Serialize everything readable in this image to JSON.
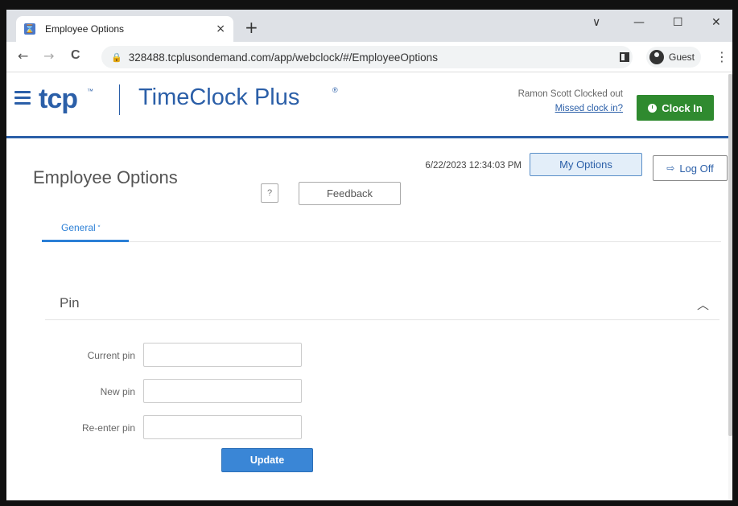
{
  "browser": {
    "tab_title": "Employee Options",
    "tab_close": "×",
    "new_tab": "+",
    "url": "328488.tcplusondemand.com/app/webclock/#/EmployeeOptions",
    "guest_label": "Guest",
    "nav_back": "←",
    "nav_forward": "→",
    "reload": "C",
    "window_chevron": "∨",
    "minimize": "—",
    "maximize": "☐",
    "close": "✕",
    "kebab": "⋮",
    "lock": "🔒"
  },
  "app": {
    "logo_brand": "tcp",
    "logo_tm": "™",
    "logo_product": "TimeClock Plus",
    "logo_reg": "®",
    "clock_status": "Ramon Scott Clocked out",
    "missed_link": "Missed clock in?",
    "clock_in_label": "Clock In",
    "accent_color": "#2b5fa8",
    "clock_in_color": "#2f8a2f"
  },
  "page": {
    "title": "Employee Options",
    "help_label": "?",
    "feedback_label": "Feedback",
    "datetime": "6/22/2023 12:34:03 PM",
    "my_options_label": "My Options",
    "log_off_label": "Log Off",
    "log_off_icon": "⇨"
  },
  "tabs": {
    "general_label": "General",
    "general_chevron": "˅"
  },
  "pin": {
    "section_title": "Pin",
    "toggle": "︿",
    "current_label": "Current pin",
    "new_label": "New pin",
    "reenter_label": "Re-enter pin",
    "current_value": "",
    "new_value": "",
    "reenter_value": "",
    "update_label": "Update"
  }
}
